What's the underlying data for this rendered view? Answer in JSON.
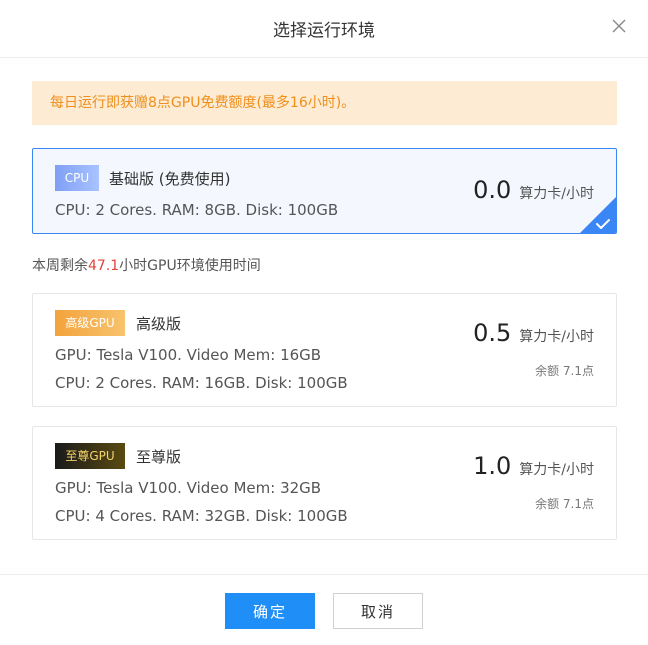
{
  "dialog": {
    "title": "选择运行环境",
    "notice": "每日运行即获赠8点GPU免费额度(最多16小时)。",
    "quota": {
      "prefix": "本周剩余",
      "hours": "47.1",
      "suffix": "小时GPU环境使用时间"
    },
    "plans": [
      {
        "badge": "CPU",
        "name": "基础版 (免费使用)",
        "specs": [
          "CPU: 2 Cores. RAM: 8GB. Disk: 100GB"
        ],
        "price": "0.0",
        "unit": "算力卡/小时",
        "selected": true
      },
      {
        "badge": "高级GPU",
        "name": "高级版",
        "specs": [
          "GPU: Tesla V100. Video Mem: 16GB",
          "CPU: 2 Cores. RAM: 16GB. Disk: 100GB"
        ],
        "price": "0.5",
        "unit": "算力卡/小时",
        "balance": "余额 7.1点",
        "selected": false
      },
      {
        "badge": "至尊GPU",
        "name": "至尊版",
        "specs": [
          "GPU: Tesla V100. Video Mem: 32GB",
          "CPU: 4 Cores. RAM: 32GB. Disk: 100GB"
        ],
        "price": "1.0",
        "unit": "算力卡/小时",
        "balance": "余额 7.1点",
        "selected": false
      }
    ],
    "buttons": {
      "ok": "确定",
      "cancel": "取消"
    }
  },
  "icons": {
    "close": "close-icon",
    "check": "check-icon"
  },
  "colors": {
    "accent": "#1f8ff7",
    "selected_border": "#3a86f5",
    "notice_bg": "#fdebd3",
    "notice_text": "#ef8f1b",
    "highlight": "#e0453b"
  }
}
